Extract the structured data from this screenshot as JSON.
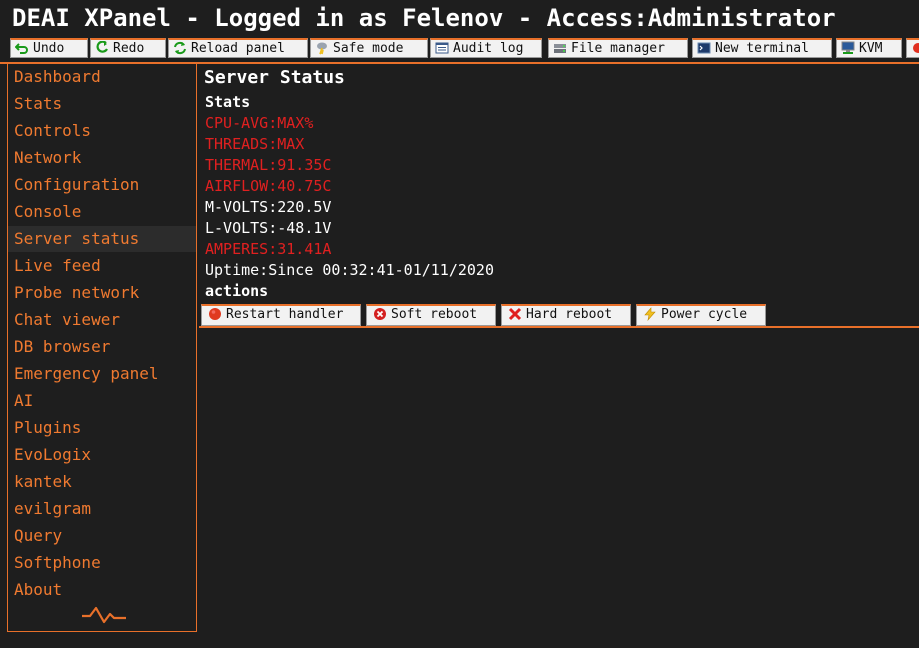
{
  "window": {
    "title": "DEAI XPanel - Logged in as Felenov - Access:Administrator"
  },
  "toolbar": {
    "buttons": [
      {
        "label": "Undo",
        "icon": "undo-icon"
      },
      {
        "label": "Redo",
        "icon": "redo-icon"
      },
      {
        "label": "Reload panel",
        "icon": "reload-icon"
      },
      {
        "label": "Safe mode",
        "icon": "safe-mode-icon"
      },
      {
        "label": "Audit log",
        "icon": "audit-log-icon"
      },
      {
        "label": "File manager",
        "icon": "file-manager-icon"
      },
      {
        "label": "New terminal",
        "icon": "terminal-icon"
      },
      {
        "label": "KVM",
        "icon": "kvm-icon"
      }
    ]
  },
  "sidebar": {
    "items": [
      {
        "label": "Dashboard"
      },
      {
        "label": "Stats"
      },
      {
        "label": "Controls"
      },
      {
        "label": "Network"
      },
      {
        "label": "Configuration"
      },
      {
        "label": "Console"
      },
      {
        "label": "Server status",
        "active": true
      },
      {
        "label": "Live feed"
      },
      {
        "label": "Probe network"
      },
      {
        "label": "Chat viewer"
      },
      {
        "label": "DB browser"
      },
      {
        "label": "Emergency panel"
      },
      {
        "label": "AI"
      },
      {
        "label": "Plugins"
      },
      {
        "label": "EvoLogix"
      },
      {
        "label": "kantek"
      },
      {
        "label": "evilgram"
      },
      {
        "label": "Query"
      },
      {
        "label": "Softphone"
      },
      {
        "label": "About"
      }
    ],
    "logo_icon": "heartbeat-logo-icon"
  },
  "main": {
    "title": "Server Status",
    "stats_label": "Stats",
    "stats": [
      {
        "text": "CPU-AVG:MAX%",
        "status": "alert"
      },
      {
        "text": "THREADS:MAX",
        "status": "alert"
      },
      {
        "text": "THERMAL:91.35C",
        "status": "alert"
      },
      {
        "text": "AIRFLOW:40.75C",
        "status": "alert"
      },
      {
        "text": "M-VOLTS:220.5V",
        "status": "normal"
      },
      {
        "text": "L-VOLTS:-48.1V",
        "status": "normal"
      },
      {
        "text": "AMPERES:31.41A",
        "status": "alert"
      },
      {
        "text": "Uptime:Since 00:32:41-01/11/2020",
        "status": "normal"
      }
    ],
    "actions_label": "actions",
    "actions": [
      {
        "label": "Restart handler",
        "icon": "red-circle-icon"
      },
      {
        "label": "Soft reboot",
        "icon": "red-x-circle-icon"
      },
      {
        "label": "Hard reboot",
        "icon": "red-x-icon"
      },
      {
        "label": "Power cycle",
        "icon": "lightning-icon"
      }
    ]
  },
  "colors": {
    "accent": "#e8702a",
    "nav_text": "#f07a30",
    "alert_text": "#e02020",
    "background": "#1e1e1e"
  }
}
